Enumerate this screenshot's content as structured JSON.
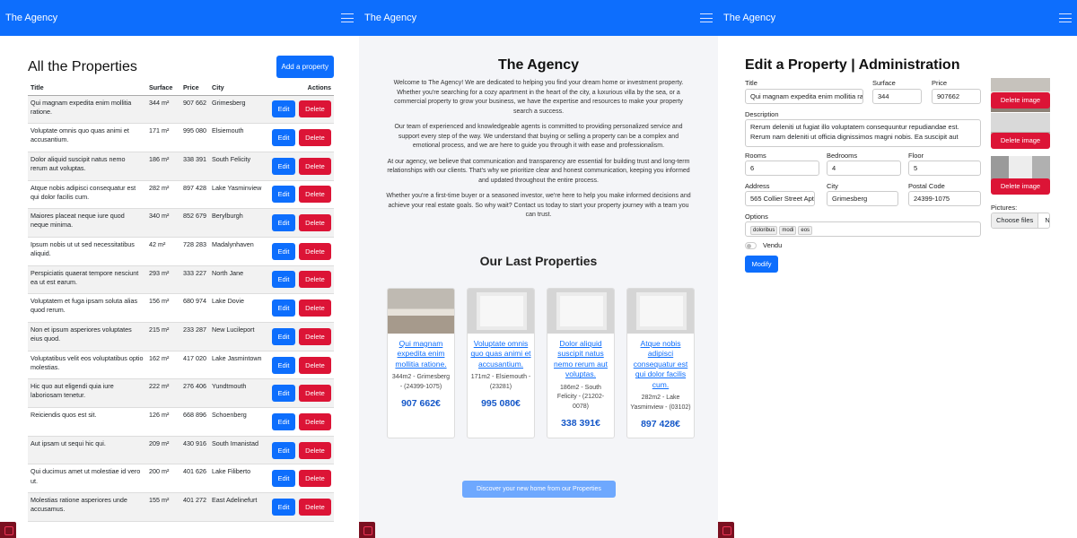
{
  "brand": "The Agency",
  "list_page": {
    "title": "All the Properties",
    "add_button": "Add a property",
    "columns": [
      "Title",
      "Surface",
      "Price",
      "City",
      "Actions"
    ],
    "edit_label": "Edit",
    "delete_label": "Delete",
    "rows": [
      {
        "title": "Qui magnam expedita enim mollitia ratione.",
        "surface": "344 m²",
        "price": "907 662",
        "city": "Grimesberg"
      },
      {
        "title": "Voluptate omnis quo quas animi et accusantium.",
        "surface": "171 m²",
        "price": "995 080",
        "city": "Elsiemouth"
      },
      {
        "title": "Dolor aliquid suscipit natus nemo rerum aut voluptas.",
        "surface": "186 m²",
        "price": "338 391",
        "city": "South Felicity"
      },
      {
        "title": "Atque nobis adipisci consequatur est qui dolor facilis cum.",
        "surface": "282 m²",
        "price": "897 428",
        "city": "Lake Yasminview"
      },
      {
        "title": "Maiores placeat neque iure quod neque minima.",
        "surface": "340 m²",
        "price": "852 679",
        "city": "Berylburgh"
      },
      {
        "title": "Ipsum nobis ut ut sed necessitatibus aliquid.",
        "surface": "42 m²",
        "price": "728 283",
        "city": "Madalynhaven"
      },
      {
        "title": "Perspiciatis quaerat tempore nesciunt ea ut est earum.",
        "surface": "293 m²",
        "price": "333 227",
        "city": "North Jane"
      },
      {
        "title": "Voluptatem et fuga ipsam soluta alias quod rerum.",
        "surface": "156 m²",
        "price": "680 974",
        "city": "Lake Dovie"
      },
      {
        "title": "Non et ipsum asperiores voluptates eius quod.",
        "surface": "215 m²",
        "price": "233 287",
        "city": "New Lucileport"
      },
      {
        "title": "Voluptatibus velit eos voluptatibus optio molestias.",
        "surface": "162 m²",
        "price": "417 020",
        "city": "Lake Jasmintown"
      },
      {
        "title": "Hic quo aut eligendi quia iure laboriosam tenetur.",
        "surface": "222 m²",
        "price": "276 406",
        "city": "Yundtmouth"
      },
      {
        "title": "Reiciendis quos est sit.",
        "surface": "126 m²",
        "price": "668 896",
        "city": "Schoenberg"
      },
      {
        "title": "Aut ipsam ut sequi hic qui.",
        "surface": "209 m²",
        "price": "430 916",
        "city": "South Imanistad"
      },
      {
        "title": "Qui ducimus amet ut molestiae id vero ut.",
        "surface": "200 m²",
        "price": "401 626",
        "city": "Lake Filiberto"
      },
      {
        "title": "Molestias ratione asperiores unde accusamus.",
        "surface": "155 m²",
        "price": "401 272",
        "city": "East Adelinefurt"
      }
    ]
  },
  "home_page": {
    "title": "The Agency",
    "paragraphs": [
      "Welcome to The Agency! We are dedicated to helping you find your dream home or investment property. Whether you're searching for a cozy apartment in the heart of the city, a luxurious villa by the sea, or a commercial property to grow your business, we have the expertise and resources to make your property search a success.",
      "Our team of experienced and knowledgeable agents is committed to providing personalized service and support every step of the way. We understand that buying or selling a property can be a complex and emotional process, and we are here to guide you through it with ease and professionalism.",
      "At our agency, we believe that communication and transparency are essential for building trust and long-term relationships with our clients. That's why we prioritize clear and honest communication, keeping you informed and updated throughout the entire process.",
      "Whether you're a first-time buyer or a seasoned investor, we're here to help you make informed decisions and achieve your real estate goals. So why wait? Contact us today to start your property journey with a team you can trust."
    ],
    "subtitle": "Our Last Properties",
    "cards": [
      {
        "title": "Qui magnam expedita enim mollitia ratione.",
        "info": "344m2 - Grimesberg - (24399-1075)",
        "price": "907 662€"
      },
      {
        "title": "Voluptate omnis quo quas animi et accusantium.",
        "info": "171m2 - Elsiemouth - (23281)",
        "price": "995 080€"
      },
      {
        "title": "Dolor aliquid suscipit natus nemo rerum aut voluptas.",
        "info": "186m2 - South Felicity - (21202-0078)",
        "price": "338 391€"
      },
      {
        "title": "Atque nobis adipisci consequatur est qui dolor facilis cum.",
        "info": "282m2 - Lake Yasminview - (03102)",
        "price": "897 428€"
      }
    ],
    "discover_button": "Discover your new home from our Properties"
  },
  "edit_page": {
    "title": "Edit a Property | Administration",
    "labels": {
      "title": "Title",
      "surface": "Surface",
      "price": "Price",
      "description": "Description",
      "rooms": "Rooms",
      "bedrooms": "Bedrooms",
      "floor": "Floor",
      "address": "Address",
      "city": "City",
      "postal": "Postal Code",
      "options": "Options",
      "sold": "Vendu",
      "pictures": "Pictures:"
    },
    "values": {
      "title": "Qui magnam expedita enim mollitia ratione.",
      "surface": "344",
      "price": "907662",
      "description_1": "Rerum deleniti ut fugiat illo voluptatem consequuntur repudiandae est.",
      "description_2": "Rerum nam deleniti ut officia dignissimos magni nobis. Ea suscipit aut",
      "rooms": "6",
      "bedrooms": "4",
      "floor": "5",
      "address": "565 Collier Street Apt.",
      "city": "Grimesberg",
      "postal": "24399-1075"
    },
    "option_chips": [
      "doloribus",
      "modi",
      "eos"
    ],
    "modify_button": "Modify",
    "delete_image_label": "Delete image",
    "file_button": "Choose files",
    "file_text": "N"
  }
}
